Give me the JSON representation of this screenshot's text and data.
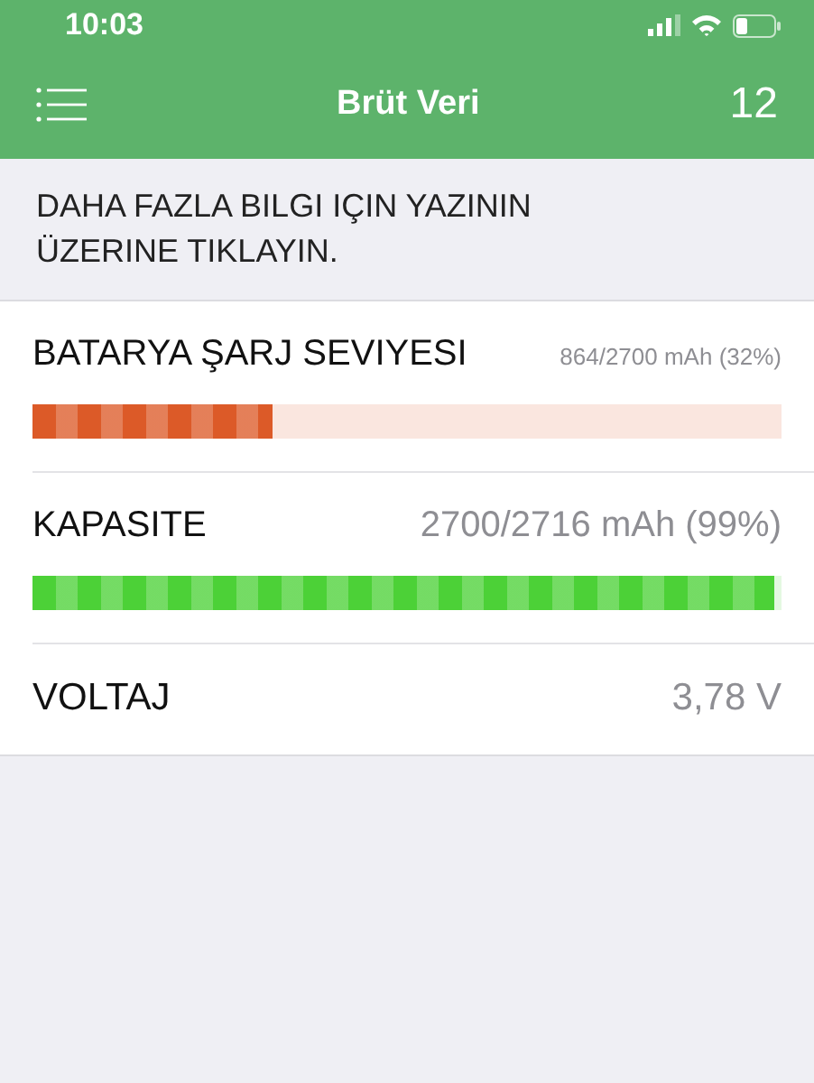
{
  "status_bar": {
    "time": "10:03"
  },
  "nav_bar": {
    "title": "Brüt Veri",
    "count": "12"
  },
  "hint": "DAHA FAZLA BILGI IÇIN YAZININ ÜZERINE TIKLAYIN.",
  "rows": [
    {
      "kind": "bar",
      "label": "BATARYA ŞARJ SEVIYESI",
      "reading": "864/2700 mAh (32%)",
      "small_reading": true,
      "level": 0.32,
      "color": "#dc5a28"
    },
    {
      "kind": "bar",
      "label": "KAPASITE",
      "reading": "2700/2716 mAh (99%)",
      "small_reading": false,
      "level": 0.99,
      "color": "#4cd137"
    },
    {
      "kind": "value",
      "label": "VOLTAJ",
      "reading": "3,78 V",
      "small_reading": false
    }
  ]
}
